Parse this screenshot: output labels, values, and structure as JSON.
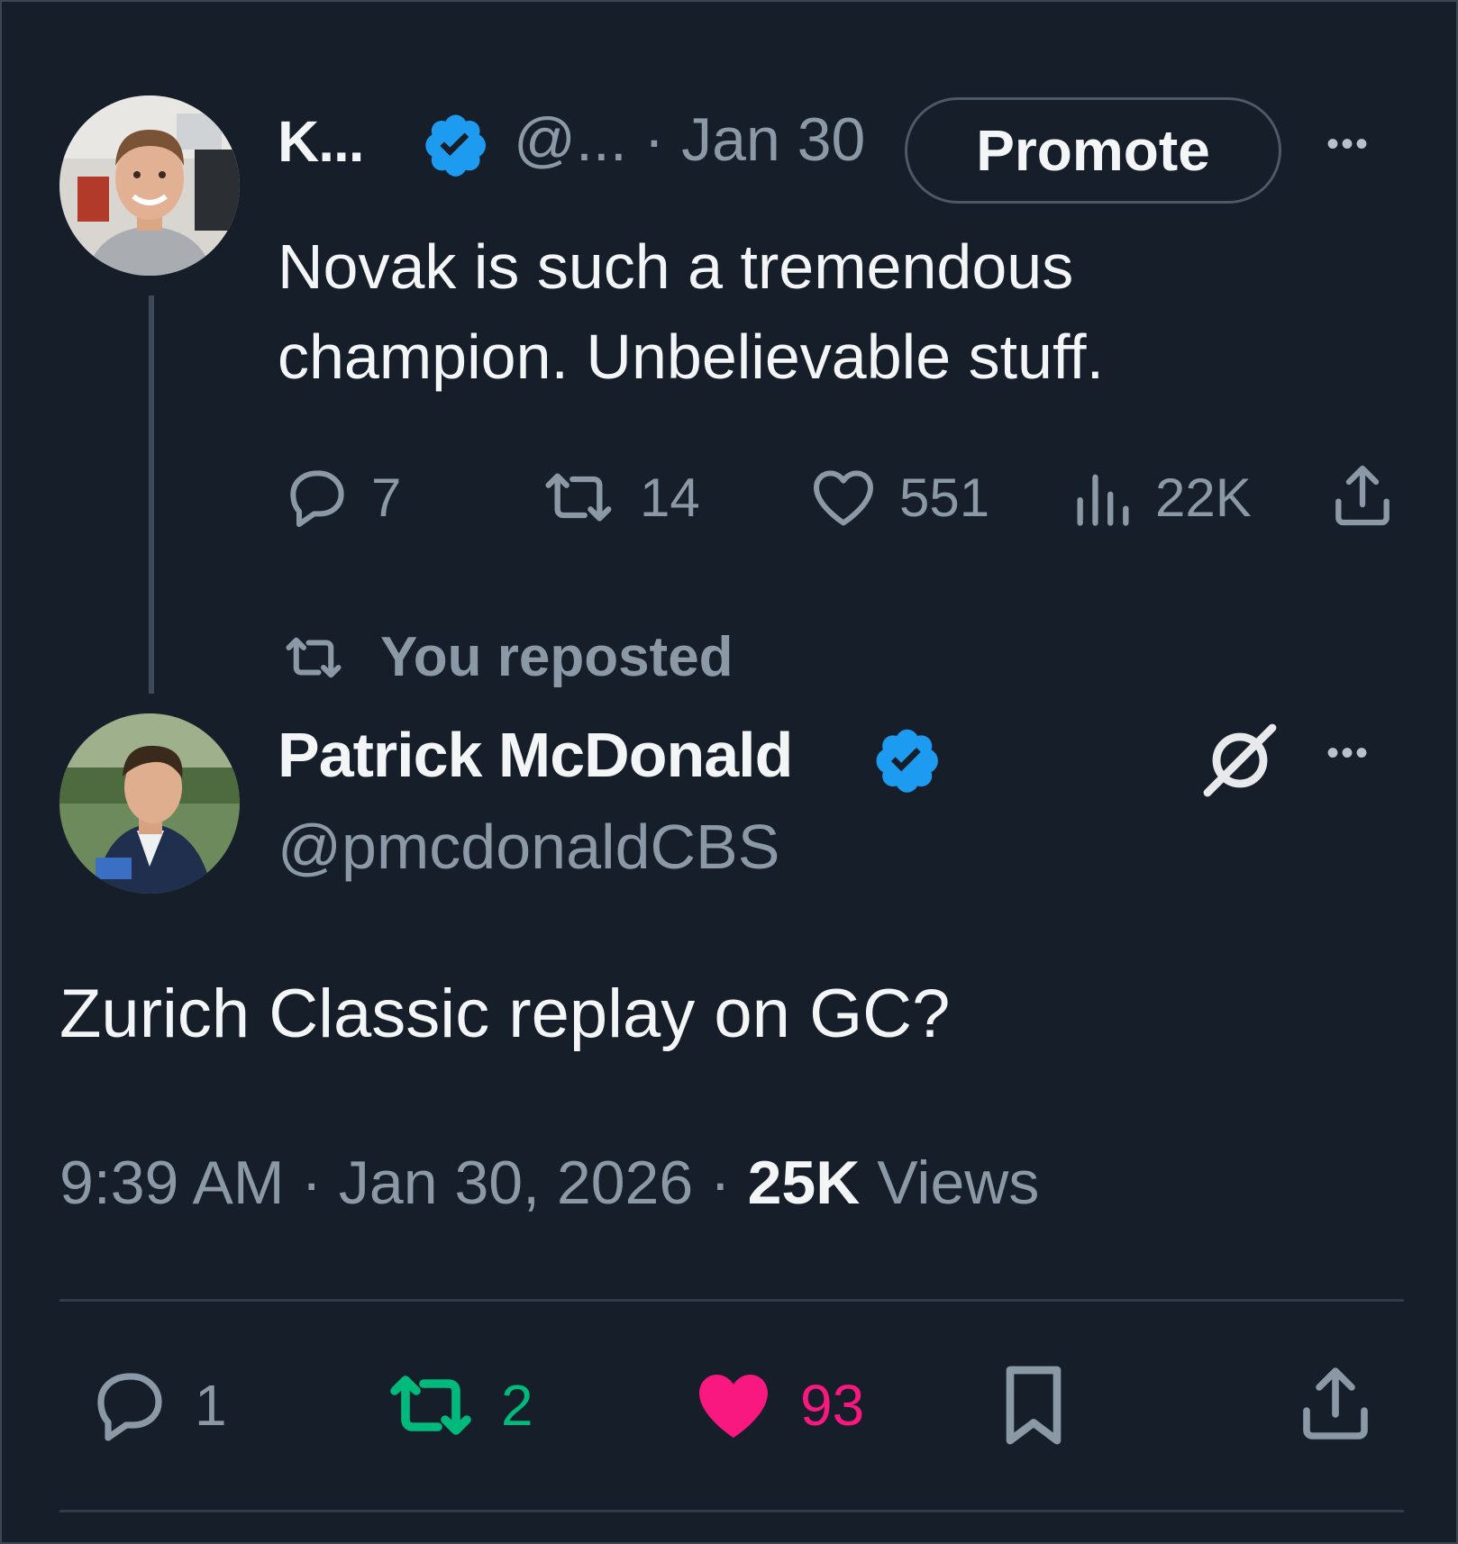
{
  "colors": {
    "background": "#161e2a",
    "verified_blue": "#1d9bf0",
    "muted": "#8b98a5",
    "repost_green": "#00ba7c",
    "like_pink": "#f91880"
  },
  "parent_post": {
    "display_name": "K...",
    "handle": "@...",
    "date": "· Jan 30",
    "promote_label": "Promote",
    "more_label": "•••",
    "text": "Novak is such a tremendous champion. Unbelievable stuff.",
    "actions": {
      "replies": "7",
      "reposts": "14",
      "likes": "551",
      "views": "22K"
    },
    "icons": [
      "verified-badge-icon",
      "reply-icon",
      "repost-icon",
      "like-icon",
      "views-icon",
      "share-icon",
      "more-icon"
    ]
  },
  "repost_note": "You reposted",
  "main_post": {
    "display_name": "Patrick McDonald",
    "handle": "@pmcdonaldCBS",
    "more_label": "•••",
    "text": "Zurich Classic replay on GC?",
    "time": "9:39 AM · Jan 30, 2026 · ",
    "views_count": "25K",
    "views_label": " Views",
    "actions": {
      "replies": "1",
      "reposts": "2",
      "likes": "93"
    },
    "icons": [
      "verified-badge-icon",
      "grok-icon",
      "more-icon",
      "reply-icon",
      "repost-icon",
      "like-icon",
      "bookmark-icon",
      "share-icon"
    ]
  }
}
